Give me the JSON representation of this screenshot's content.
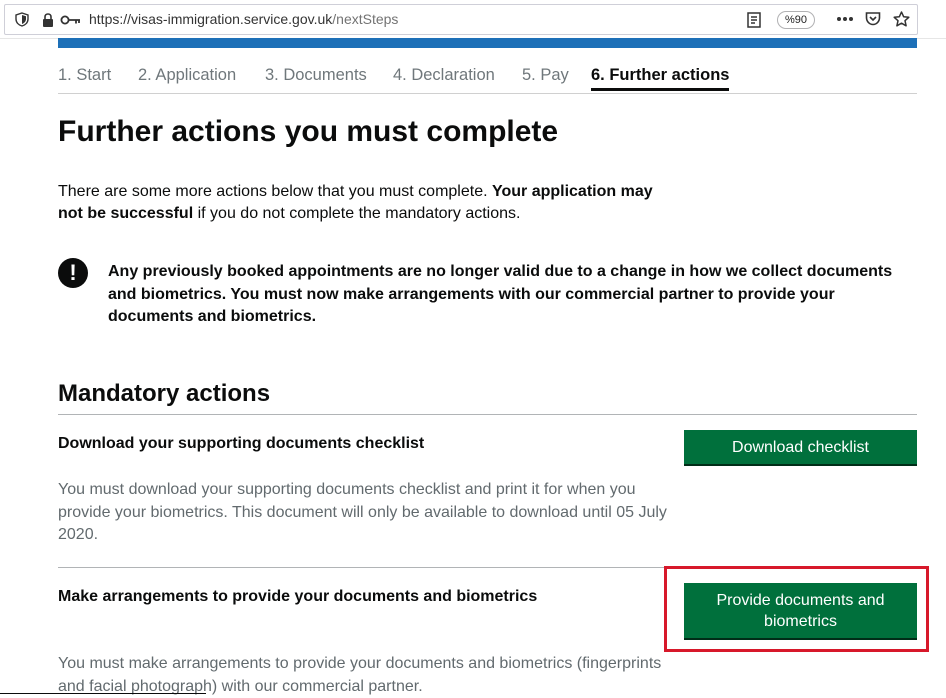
{
  "browser": {
    "url_domain": "https://visas-immigration.service.gov.uk",
    "url_path": "/nextSteps",
    "zoom_level": "%90",
    "icons": [
      "shield-icon",
      "lock-icon",
      "key-icon",
      "reader-view-icon",
      "more-icon",
      "pocket-icon",
      "star-icon"
    ]
  },
  "steps": [
    {
      "label": "1. Start"
    },
    {
      "label": "2. Application"
    },
    {
      "label": "3. Documents"
    },
    {
      "label": "4. Declaration"
    },
    {
      "label": "5. Pay"
    },
    {
      "label": "6. Further actions",
      "current": true
    }
  ],
  "page_title": "Further actions you must complete",
  "intro": {
    "text_before": "There are some more actions below that you must complete. ",
    "bold": "Your application may not be successful",
    "text_after": " if you do not complete the mandatory actions."
  },
  "warning": {
    "icon_glyph": "!",
    "text": "Any previously booked appointments are no longer valid due to a change in how we collect documents and biometrics. You must now make arrangements with our commercial partner to provide your documents and biometrics."
  },
  "mandatory": {
    "heading": "Mandatory actions",
    "actions": [
      {
        "title": "Download your supporting documents checklist",
        "description": "You must download your supporting documents checklist and print it for when you provide your biometrics. This document will only be available to download until 05 July 2020.",
        "button_label": "Download checklist"
      },
      {
        "title": "Make arrangements to provide your documents and biometrics",
        "description": "You must make arrangements to provide your documents and biometrics (fingerprints and facial photograph) with our commercial partner.",
        "button_label": "Provide documents and biometrics"
      }
    ]
  },
  "colors": {
    "gov_blue": "#1d70b8",
    "button_green": "#00703c",
    "highlight_red": "#d7182a"
  }
}
